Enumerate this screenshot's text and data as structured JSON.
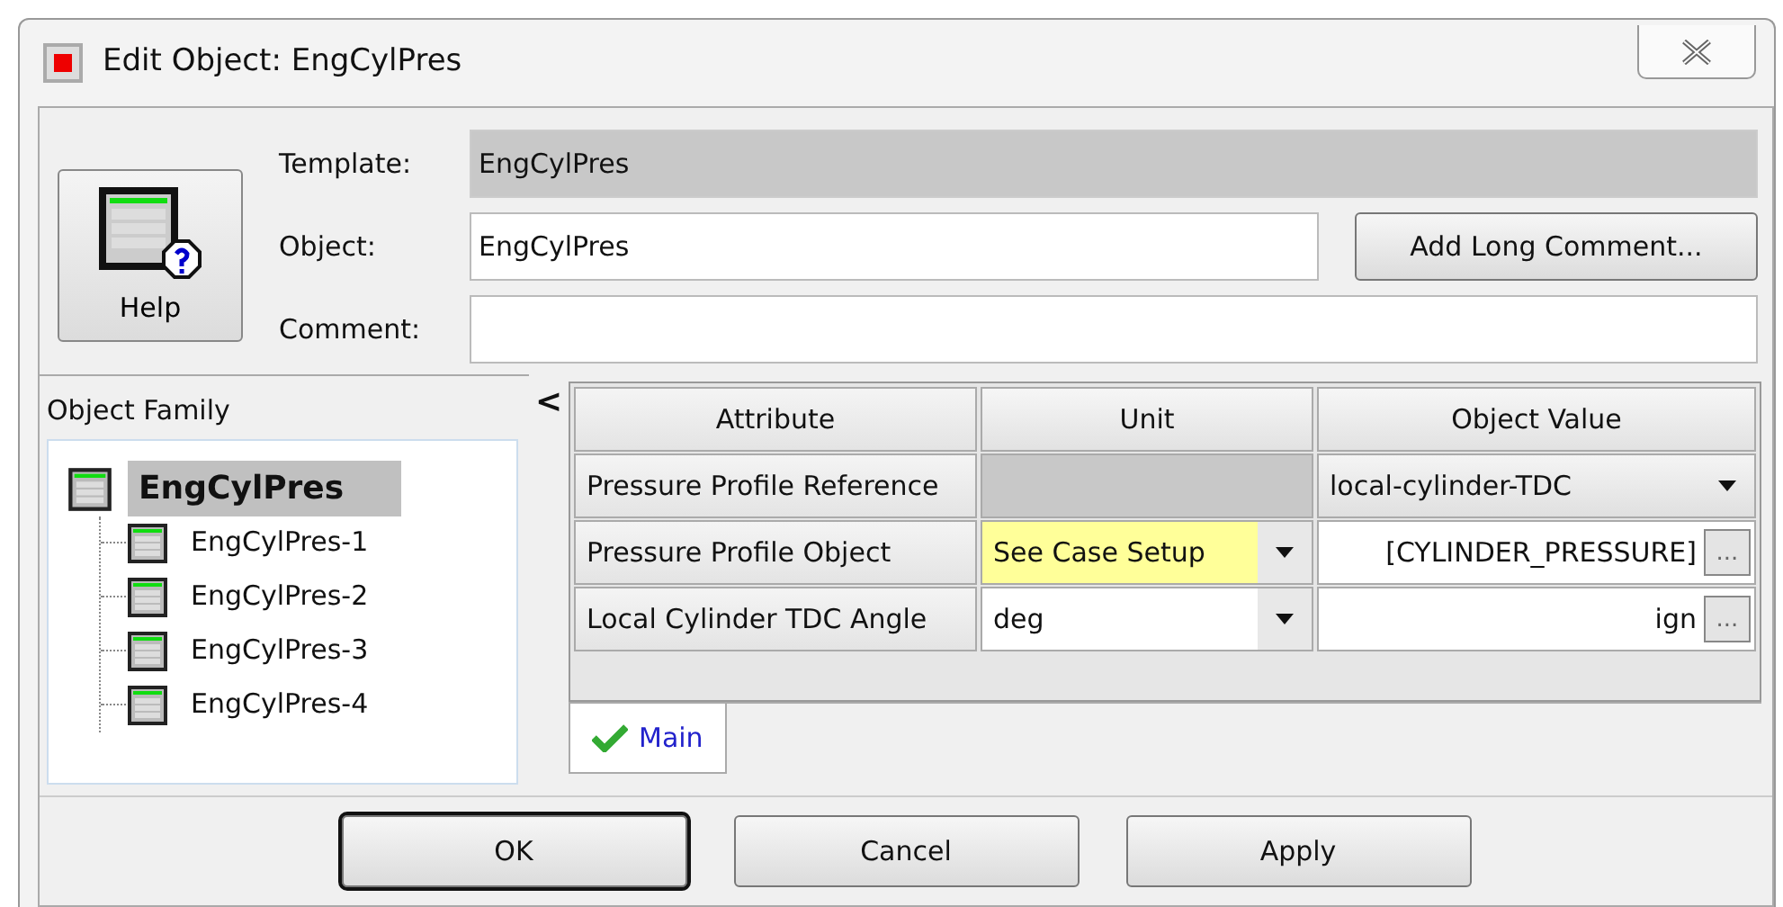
{
  "window": {
    "title": "Edit Object: EngCylPres"
  },
  "help_button": {
    "label": "Help"
  },
  "fields": [
    {
      "label": "Template:",
      "value": "EngCylPres",
      "disabled": true
    },
    {
      "label": "Object:",
      "value": "EngCylPres",
      "disabled": false
    },
    {
      "label": "Comment:",
      "disabled": false
    }
  ],
  "add_comment_button": {
    "label": "Add Long Comment..."
  },
  "object_family": {
    "title": "Object Family",
    "tree": [
      {
        "label": "EngCylPres",
        "selected": true,
        "children": [
          {
            "label": "EngCylPres-1",
            "selected": false
          },
          {
            "label": "EngCylPres-2",
            "selected": false
          },
          {
            "label": "EngCylPres-3",
            "selected": false
          },
          {
            "label": "EngCylPres-4",
            "selected": false
          }
        ]
      }
    ]
  },
  "collapse_toggle": "<",
  "table": {
    "columns": [
      "Attribute",
      "Unit",
      "Object Value"
    ],
    "rows": [
      {
        "attribute": "Pressure Profile Reference",
        "unit": {
          "kind": "empty"
        },
        "value": {
          "kind": "dropdown",
          "text": "local-cylinder-TDC"
        }
      },
      {
        "attribute": "Pressure Profile Object",
        "unit": {
          "kind": "dropdown",
          "text": "See Case Setup",
          "highlighted": true
        },
        "value": {
          "kind": "browse",
          "text": "[CYLINDER_PRESSURE]",
          "button": "..."
        }
      },
      {
        "attribute": "Local Cylinder TDC Angle",
        "unit": {
          "kind": "dropdown",
          "text": "deg",
          "highlighted": false
        },
        "value": {
          "kind": "browse",
          "text": "ign",
          "button": "..."
        }
      }
    ]
  },
  "tabs": [
    {
      "label": "Main",
      "selected": true,
      "checked": true
    }
  ],
  "buttons": [
    {
      "label": "OK",
      "default": true
    },
    {
      "label": "Cancel",
      "default": false
    },
    {
      "label": "Apply",
      "default": false
    }
  ]
}
